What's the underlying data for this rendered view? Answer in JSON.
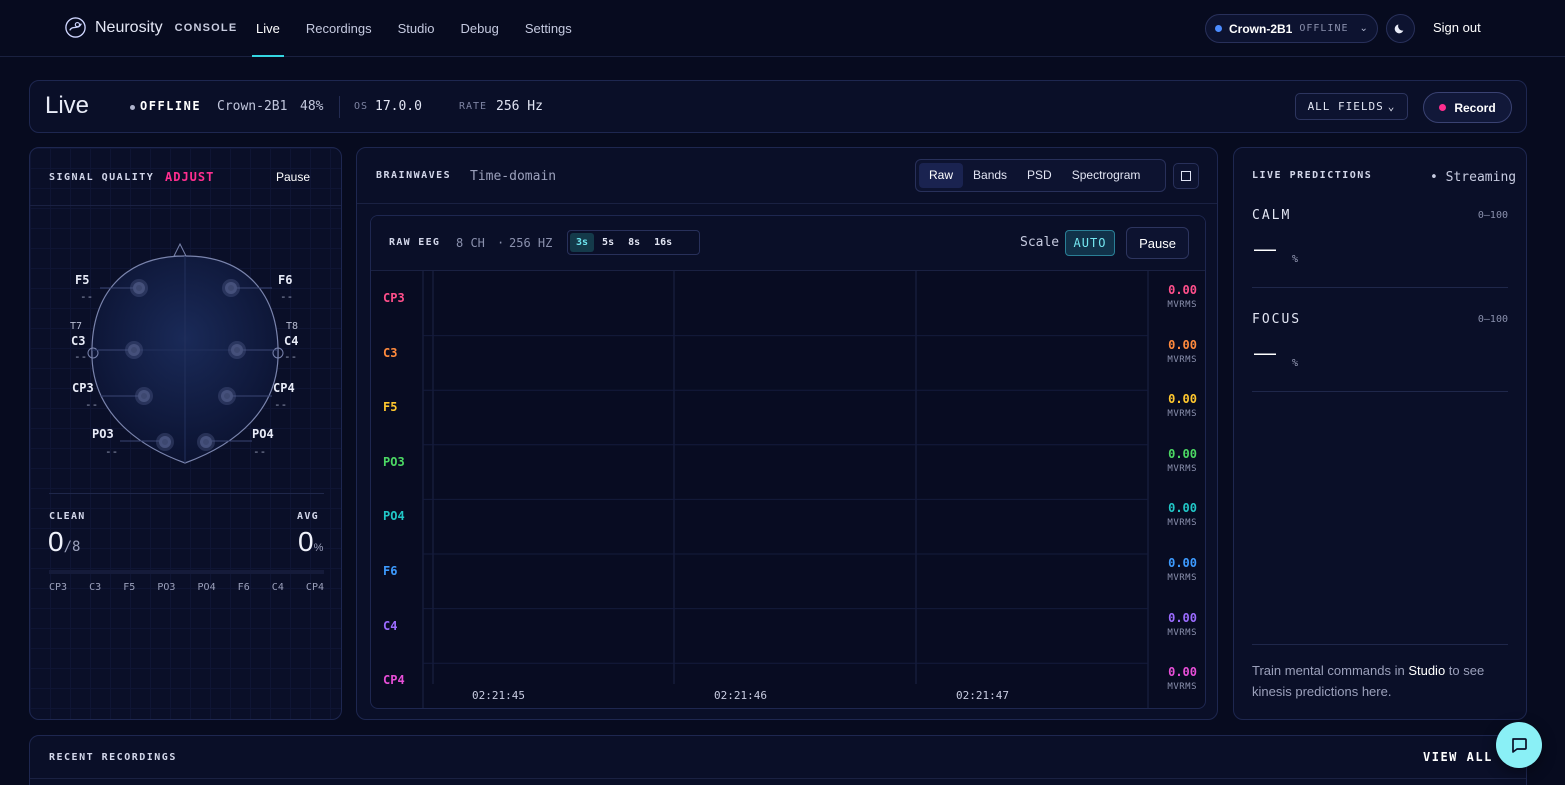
{
  "app": {
    "name": "Neurosity",
    "sub": "CONSOLE"
  },
  "nav": {
    "links": [
      "Live",
      "Recordings",
      "Studio",
      "Debug",
      "Settings"
    ]
  },
  "device": {
    "name": "Crown-2B1",
    "status": "OFFLINE",
    "sign_out": "Sign out"
  },
  "statusbar": {
    "title": "Live",
    "status": "OFFLINE",
    "device": "Crown-2B1",
    "battery": "48%",
    "os_label": "OS",
    "os_value": "17.0.0",
    "rate_label": "RATE",
    "rate_value": "256 Hz",
    "all_fields": "ALL FIELDS",
    "record": "Record"
  },
  "signal": {
    "label": "SIGNAL QUALITY",
    "adjust": "ADJUST",
    "pause": "Pause",
    "electrodes": [
      {
        "name": "F5",
        "value": "--"
      },
      {
        "name": "F6",
        "value": "--"
      },
      {
        "name": "T7",
        "value": ""
      },
      {
        "name": "T8",
        "value": ""
      },
      {
        "name": "C3",
        "value": "--"
      },
      {
        "name": "C4",
        "value": "--"
      },
      {
        "name": "CP3",
        "value": "--"
      },
      {
        "name": "CP4",
        "value": "--"
      },
      {
        "name": "PO3",
        "value": "--"
      },
      {
        "name": "PO4",
        "value": "--"
      }
    ],
    "clean_label": "CLEAN",
    "clean_value": "0",
    "clean_total": "/8",
    "avg_label": "AVG",
    "avg_value": "0",
    "avg_unit": "%",
    "channels": [
      "CP3",
      "C3",
      "F5",
      "PO3",
      "PO4",
      "F6",
      "C4",
      "CP4"
    ]
  },
  "brainwaves": {
    "label": "BRAINWAVES",
    "sub": "Time-domain",
    "tabs": [
      "Raw",
      "Bands",
      "PSD",
      "Spectrogram"
    ],
    "raw_label": "RAW EEG",
    "channels_count": "8 CH",
    "dot": "·",
    "hz": "256 HZ",
    "windows": [
      "3s",
      "5s",
      "8s",
      "16s"
    ],
    "scale_label": "Scale",
    "scale_value": "AUTO",
    "pause": "Pause",
    "channels": [
      {
        "name": "CP3",
        "value": "0.00",
        "unit": "MVRMS",
        "color": "#ff4f8b"
      },
      {
        "name": "C3",
        "value": "0.00",
        "unit": "MVRMS",
        "color": "#ff8a3d"
      },
      {
        "name": "F5",
        "value": "0.00",
        "unit": "MVRMS",
        "color": "#ffc72e"
      },
      {
        "name": "PO3",
        "value": "0.00",
        "unit": "MVRMS",
        "color": "#4cd964"
      },
      {
        "name": "PO4",
        "value": "0.00",
        "unit": "MVRMS",
        "color": "#21c7c7"
      },
      {
        "name": "F6",
        "value": "0.00",
        "unit": "MVRMS",
        "color": "#3d9bff"
      },
      {
        "name": "C4",
        "value": "0.00",
        "unit": "MVRMS",
        "color": "#9b6bff"
      },
      {
        "name": "CP4",
        "value": "0.00",
        "unit": "MVRMS",
        "color": "#e84fd8"
      }
    ],
    "times": [
      "02:21:45",
      "02:21:46",
      "02:21:47"
    ]
  },
  "predictions": {
    "label": "LIVE PREDICTIONS",
    "stream": "• Streaming",
    "items": [
      {
        "name": "CALM",
        "range": "0–100",
        "value": "—",
        "unit": "%"
      },
      {
        "name": "FOCUS",
        "range": "0–100",
        "value": "—",
        "unit": "%"
      }
    ],
    "footer_pre": "Train mental commands in ",
    "footer_link": "Studio",
    "footer_post": " to see kinesis predictions here."
  },
  "recent": {
    "label": "RECENT RECORDINGS",
    "view_all": "VIEW ALL"
  },
  "colors": {
    "accent": "#34d6e2",
    "record": "#ff2e8f",
    "adjust": "#ff2e8f"
  }
}
